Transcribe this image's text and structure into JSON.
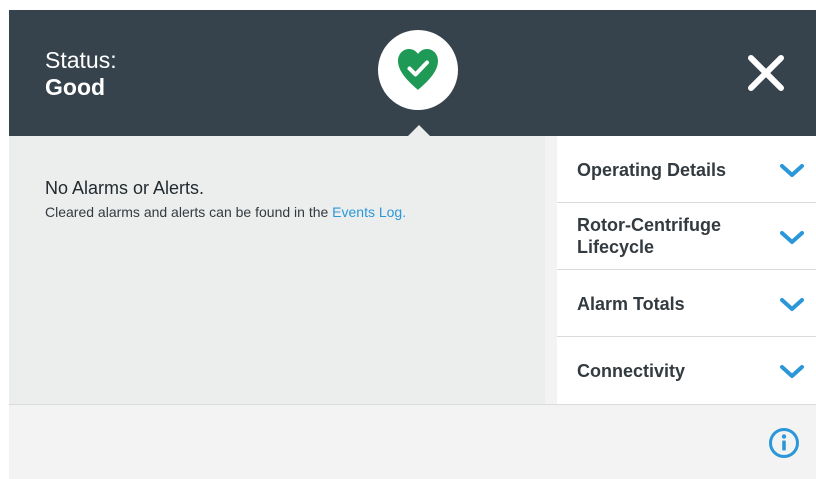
{
  "header": {
    "status_label": "Status:",
    "status_value": "Good",
    "status_icon": "heart-check-icon",
    "close_icon": "close-icon",
    "colors": {
      "header_bg": "#36434d",
      "status_good": "#1f9a56"
    }
  },
  "alarms": {
    "title": "No Alarms or Alerts.",
    "subtitle_prefix": "Cleared alarms and alerts can be found in the ",
    "link_text": "Events Log."
  },
  "side_panel": {
    "items": [
      {
        "label": "Operating Details",
        "icon": "chevron-down-icon"
      },
      {
        "label": "Rotor-Centrifuge Lifecycle",
        "icon": "chevron-down-icon"
      },
      {
        "label": "Alarm Totals",
        "icon": "chevron-down-icon"
      },
      {
        "label": "Connectivity",
        "icon": "chevron-down-icon"
      }
    ]
  },
  "footer": {
    "info_icon": "info-icon"
  },
  "colors": {
    "accent": "#2b97d9",
    "text_dark": "#333b40"
  }
}
